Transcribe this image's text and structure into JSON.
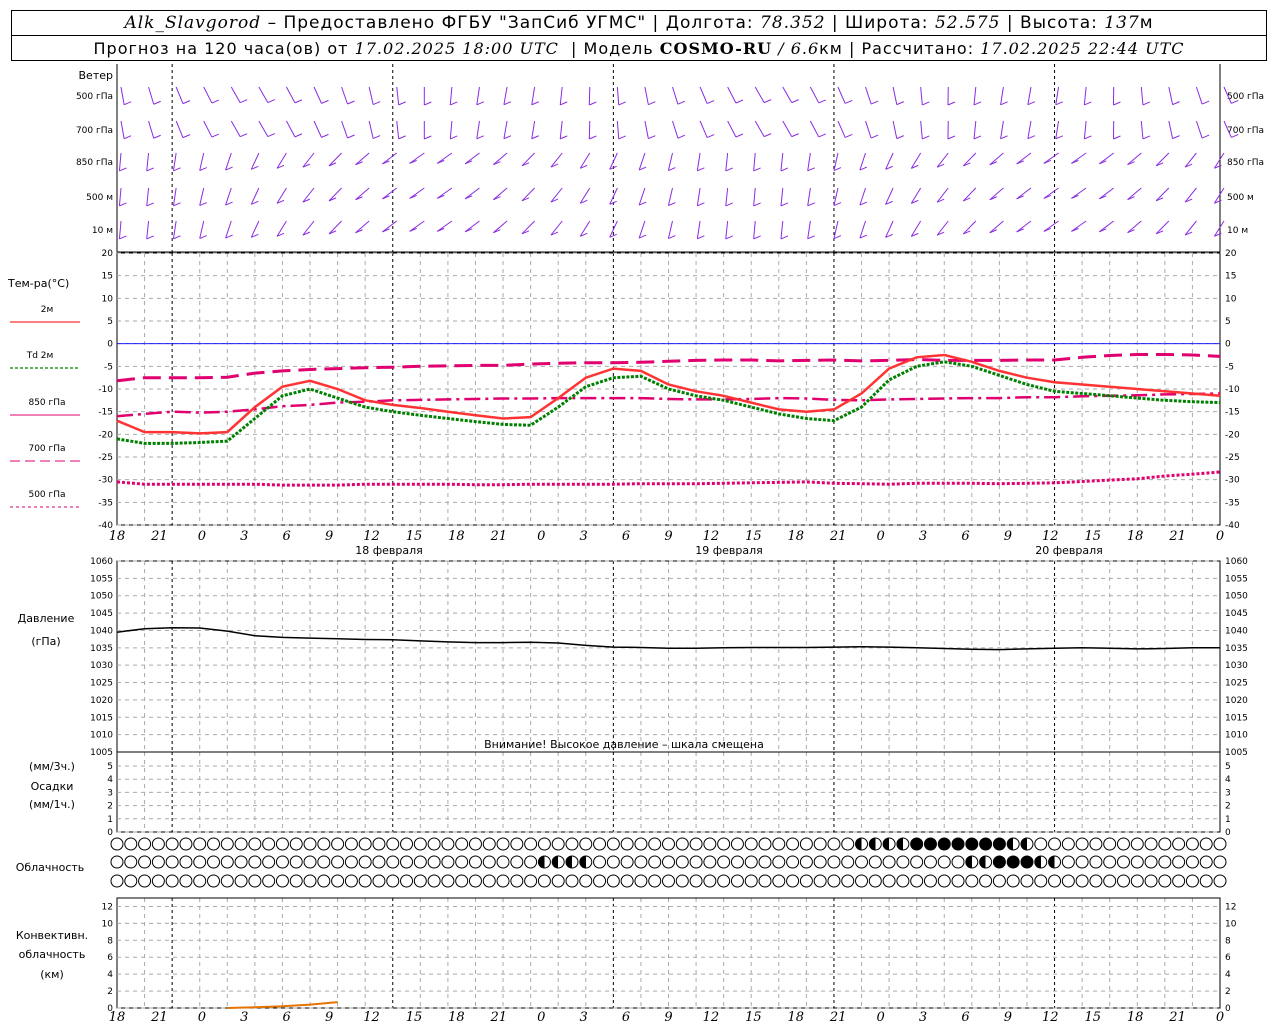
{
  "header": {
    "station": "Alk_Slavgorod",
    "provider_prefix": "– Предоставлено ФГБУ \"ЗапСиб УГМС\" | Долгота:",
    "longitude": "78.352",
    "lat_label": "| Широта:",
    "latitude": "52.575",
    "alt_label": "| Высота:",
    "altitude": "137",
    "alt_unit": "м",
    "forecast_label": "Прогноз на 120 часа(ов) от",
    "forecast_start": "17.02.2025 18:00 UTC",
    "model_label": "| Модель",
    "model_name": "COSMO-RU",
    "model_res": "/ 6.6",
    "model_unit": "км",
    "calc_label": "| Рассчитано:",
    "calc_time": "17.02.2025 22:44 UTC"
  },
  "colors": {
    "t2m": "#ff3333",
    "td2m": "#008000",
    "t850": "#e0006f",
    "t700": "#e0006f",
    "t500": "#e0006f",
    "wind": "#8a2be2",
    "zero_line": "#0000ff",
    "grid": "#aaaaaa",
    "pressure": "#000000",
    "convective": "#e67300"
  },
  "time_axis": {
    "tick_labels": [
      "18",
      "21",
      "0",
      "3",
      "6",
      "9",
      "12",
      "15",
      "18",
      "21",
      "0",
      "3",
      "6",
      "9",
      "12",
      "15",
      "18",
      "21",
      "0",
      "3",
      "6",
      "9",
      "12",
      "15",
      "18",
      "21",
      "0"
    ],
    "day_labels": [
      "18 февраля",
      "19 февраля",
      "20 февраля"
    ]
  },
  "wind_panel": {
    "title": "Ветер",
    "levels": [
      "500 гПа",
      "700 гПа",
      "850 гПа",
      "500  м",
      "10  м"
    ]
  },
  "temperature_panel": {
    "title": "Тем-ра(°C)",
    "legend": [
      "2м",
      "Td  2м",
      "850 гПа",
      "700 гПа",
      "500 гПа"
    ],
    "ylim": [
      -40,
      20
    ],
    "yticks": [
      "20",
      "15",
      "10",
      "5",
      "0",
      "-5",
      "-10",
      "-15",
      "-20",
      "-25",
      "-30",
      "-35",
      "-40"
    ]
  },
  "pressure_panel": {
    "title": "Давление",
    "unit": "(гПа)",
    "ylim": [
      1005,
      1060
    ],
    "yticks": [
      "1060",
      "1055",
      "1050",
      "1045",
      "1040",
      "1035",
      "1030",
      "1025",
      "1020",
      "1015",
      "1010",
      "1005"
    ],
    "warning": "Внимание! Высокое давление – шкала смещена"
  },
  "precip_panel": {
    "label_top": "(мм/3ч.)",
    "label_mid": "Осадки",
    "label_bot": "(мм/1ч.)",
    "yticks": [
      "5",
      "4",
      "3",
      "2",
      "1",
      "0"
    ]
  },
  "cloud_panel": {
    "title": "Облачность"
  },
  "convective_panel": {
    "label_1": "Конвективн.",
    "label_2": "облачность",
    "label_3": "(км)",
    "yticks": [
      "12",
      "10",
      "8",
      "6",
      "4",
      "2",
      "0"
    ]
  },
  "chart_data": {
    "type": "line",
    "x_hours": [
      0,
      3,
      6,
      9,
      12,
      15,
      18,
      21,
      24,
      27,
      30,
      33,
      36,
      39,
      42,
      45,
      48,
      51,
      54,
      57,
      60,
      63,
      66,
      69,
      72,
      75,
      78,
      81,
      84,
      87,
      90,
      93,
      96,
      99,
      102,
      105,
      108,
      111,
      114,
      117,
      120
    ],
    "series": [
      {
        "name": "2м",
        "values": [
          -17,
          -19.5,
          -19.5,
          -19.8,
          -19.5,
          -14,
          -9.5,
          -8.2,
          -10,
          -12.5,
          -13.5,
          -14.2,
          -15,
          -15.8,
          -16.5,
          -16.2,
          -12,
          -7.5,
          -5.5,
          -6,
          -9,
          -10.5,
          -11.5,
          -13,
          -14.5,
          -15,
          -14.5,
          -11,
          -5.5,
          -3,
          -2.5,
          -4,
          -6,
          -7.5,
          -8.5,
          -9,
          -9.5,
          -10,
          -10.5,
          -11,
          -11.5
        ]
      },
      {
        "name": "Td  2м",
        "values": [
          -21,
          -22,
          -22,
          -21.8,
          -21.5,
          -16.5,
          -11.5,
          -10,
          -12,
          -14,
          -15,
          -15.8,
          -16.5,
          -17.2,
          -17.8,
          -18,
          -14,
          -9.5,
          -7.5,
          -7.2,
          -10,
          -11.5,
          -12.5,
          -14,
          -15.5,
          -16.5,
          -17,
          -14,
          -8,
          -5,
          -4,
          -5,
          -7,
          -9,
          -10.5,
          -11,
          -11.5,
          -12,
          -12.5,
          -12.8,
          -13
        ]
      },
      {
        "name": "850 гПа",
        "values": [
          -16,
          -15.5,
          -15,
          -15.2,
          -15,
          -14.5,
          -13.8,
          -13.5,
          -13,
          -12.8,
          -12.5,
          -12.4,
          -12.3,
          -12.2,
          -12.1,
          -12.1,
          -12,
          -12,
          -12,
          -12,
          -12.2,
          -12.3,
          -12.3,
          -12.2,
          -12,
          -12.1,
          -12.4,
          -12.5,
          -12.3,
          -12.2,
          -12.1,
          -12,
          -12,
          -11.8,
          -11.8,
          -11.6,
          -11.5,
          -11.4,
          -11.2,
          -11.1,
          -11
        ]
      },
      {
        "name": "700 гПа",
        "values": [
          -8.2,
          -7.5,
          -7.5,
          -7.5,
          -7.4,
          -6.5,
          -6,
          -5.7,
          -5.5,
          -5.3,
          -5.2,
          -5,
          -4.9,
          -4.8,
          -4.8,
          -4.5,
          -4.3,
          -4.2,
          -4.2,
          -4.1,
          -3.9,
          -3.7,
          -3.6,
          -3.6,
          -3.8,
          -3.7,
          -3.6,
          -3.8,
          -3.7,
          -3.5,
          -3.7,
          -3.7,
          -3.7,
          -3.6,
          -3.6,
          -3,
          -2.6,
          -2.4,
          -2.4,
          -2.5,
          -2.8
        ]
      },
      {
        "name": "500 гПа",
        "values": [
          -30.5,
          -31,
          -31,
          -31,
          -31,
          -31,
          -31.2,
          -31.2,
          -31.2,
          -31,
          -31,
          -31,
          -31,
          -31.1,
          -31.1,
          -31,
          -31,
          -31,
          -31,
          -30.9,
          -30.9,
          -30.9,
          -30.8,
          -30.7,
          -30.6,
          -30.5,
          -30.8,
          -30.9,
          -31,
          -30.8,
          -30.8,
          -30.8,
          -30.9,
          -30.8,
          -30.7,
          -30.4,
          -30.1,
          -29.8,
          -29.2,
          -28.8,
          -28.3
        ]
      },
      {
        "name": "Давление",
        "values": [
          1039.5,
          1040.5,
          1040.8,
          1040.7,
          1039.8,
          1038.5,
          1038,
          1037.8,
          1037.6,
          1037.4,
          1037.3,
          1037,
          1036.7,
          1036.5,
          1036.5,
          1036.6,
          1036.4,
          1035.7,
          1035.2,
          1035.1,
          1034.9,
          1034.9,
          1035,
          1035.1,
          1035.1,
          1035.1,
          1035.2,
          1035.3,
          1035.2,
          1035,
          1034.8,
          1034.6,
          1034.5,
          1034.7,
          1034.9,
          1035,
          1034.9,
          1034.7,
          1034.8,
          1035,
          1035
        ]
      },
      {
        "name": "Конвективн. облачность",
        "values": [
          0,
          0,
          0,
          0,
          0,
          0.1,
          0.2,
          0.4,
          0.7,
          0,
          0,
          0,
          0,
          0,
          0,
          0,
          0,
          0,
          0,
          0,
          0,
          0,
          0,
          0,
          0,
          0,
          0,
          0,
          0,
          0,
          0,
          0,
          0,
          0,
          0,
          0,
          0,
          0,
          0,
          0,
          0
        ]
      }
    ],
    "xlabel": "",
    "ylabel": ""
  }
}
